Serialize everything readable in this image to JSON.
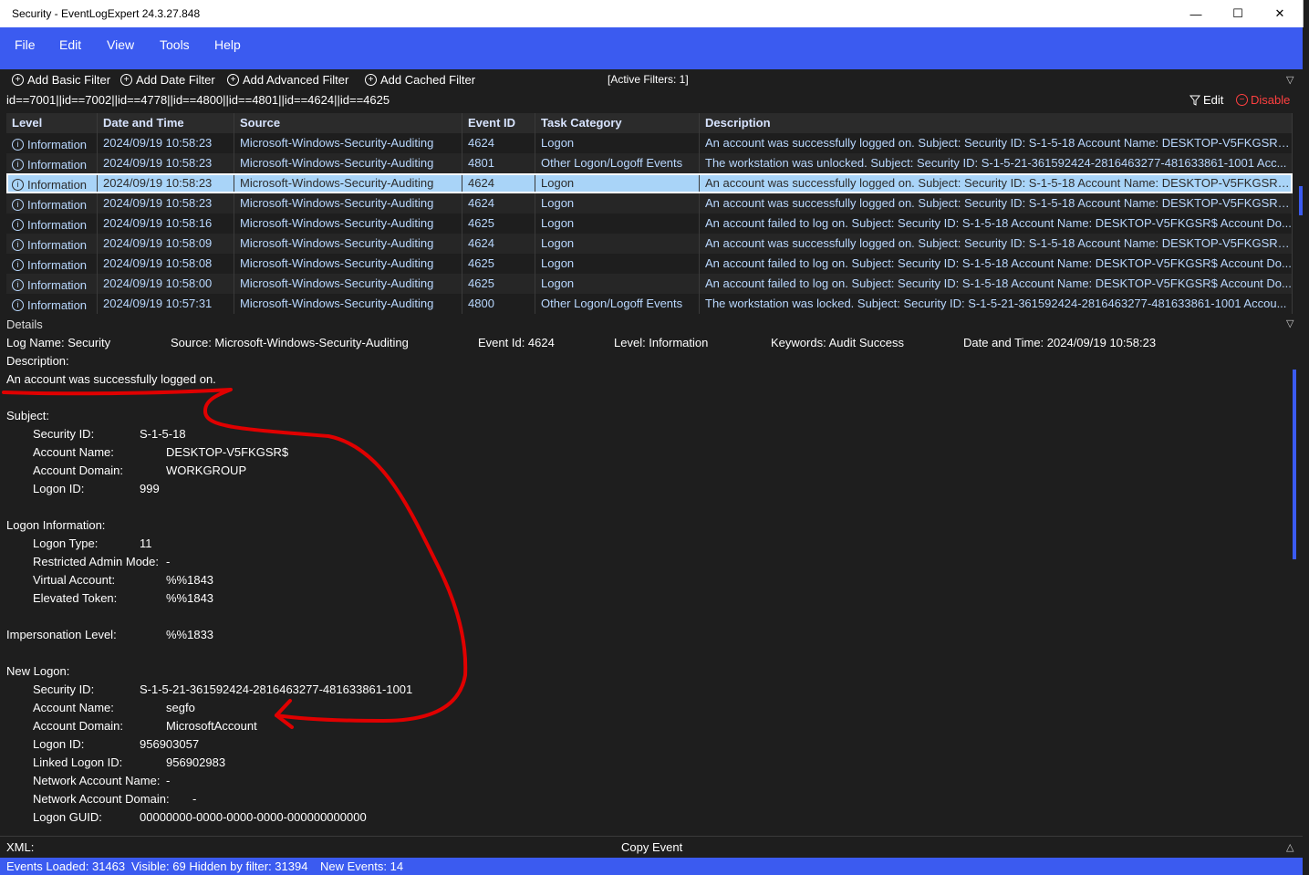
{
  "window": {
    "title": "Security - EventLogExpert 24.3.27.848",
    "minimize": "—",
    "maximize": "☐",
    "close": "✕"
  },
  "menu": [
    "File",
    "Edit",
    "View",
    "Tools",
    "Help"
  ],
  "filters": {
    "buttons": [
      "Add Basic Filter",
      "Add Date Filter",
      "Add Advanced Filter",
      "Add Cached Filter"
    ],
    "active": "[Active Filters: 1]",
    "expression": "id==7001||id==7002||id==4778||id==4800||id==4801||id==4624||id==4625",
    "edit_label": "Edit",
    "disable_label": "Disable"
  },
  "table": {
    "columns": [
      "Level",
      "Date and Time",
      "Source",
      "Event ID",
      "Task Category",
      "Description"
    ],
    "rows": [
      [
        "Information",
        "2024/09/19 10:58:23",
        "Microsoft-Windows-Security-Auditing",
        "4624",
        "Logon",
        "An account was successfully logged on. Subject: Security ID: S-1-5-18 Account Name: DESKTOP-V5FKGSR$ ..."
      ],
      [
        "Information",
        "2024/09/19 10:58:23",
        "Microsoft-Windows-Security-Auditing",
        "4801",
        "Other Logon/Logoff Events",
        "The workstation was unlocked. Subject: Security ID: S-1-5-21-361592424-2816463277-481633861-1001 Acc..."
      ],
      [
        "Information",
        "2024/09/19 10:58:23",
        "Microsoft-Windows-Security-Auditing",
        "4624",
        "Logon",
        "An account was successfully logged on. Subject: Security ID: S-1-5-18 Account Name: DESKTOP-V5FKGSR$ ..."
      ],
      [
        "Information",
        "2024/09/19 10:58:23",
        "Microsoft-Windows-Security-Auditing",
        "4624",
        "Logon",
        "An account was successfully logged on. Subject: Security ID: S-1-5-18 Account Name: DESKTOP-V5FKGSR$ ..."
      ],
      [
        "Information",
        "2024/09/19 10:58:16",
        "Microsoft-Windows-Security-Auditing",
        "4625",
        "Logon",
        "An account failed to log on. Subject: Security ID: S-1-5-18 Account Name: DESKTOP-V5FKGSR$ Account Do..."
      ],
      [
        "Information",
        "2024/09/19 10:58:09",
        "Microsoft-Windows-Security-Auditing",
        "4624",
        "Logon",
        "An account was successfully logged on. Subject: Security ID: S-1-5-18 Account Name: DESKTOP-V5FKGSR$ ..."
      ],
      [
        "Information",
        "2024/09/19 10:58:08",
        "Microsoft-Windows-Security-Auditing",
        "4625",
        "Logon",
        "An account failed to log on. Subject: Security ID: S-1-5-18 Account Name: DESKTOP-V5FKGSR$ Account Do..."
      ],
      [
        "Information",
        "2024/09/19 10:58:00",
        "Microsoft-Windows-Security-Auditing",
        "4625",
        "Logon",
        "An account failed to log on. Subject: Security ID: S-1-5-18 Account Name: DESKTOP-V5FKGSR$ Account Do..."
      ],
      [
        "Information",
        "2024/09/19 10:57:31",
        "Microsoft-Windows-Security-Auditing",
        "4800",
        "Other Logon/Logoff Events",
        "The workstation was locked. Subject: Security ID: S-1-5-21-361592424-2816463277-481633861-1001 Accou..."
      ]
    ],
    "selected_row": 2
  },
  "details": {
    "label": "Details",
    "log_name": "Log Name: Security",
    "source": "Source: Microsoft-Windows-Security-Auditing",
    "event_id": "Event Id: 4624",
    "level": "Level: Information",
    "keywords": "Keywords: Audit Success",
    "date_time": "Date and Time: 2024/09/19 10:58:23",
    "description_label": "Description:",
    "description": "An account was successfully logged on.",
    "subject_label": "Subject:",
    "subject": [
      [
        "Security ID:",
        "S-1-5-18"
      ],
      [
        "Account Name:",
        "DESKTOP-V5FKGSR$"
      ],
      [
        "Account Domain:",
        "WORKGROUP"
      ],
      [
        "Logon ID:",
        "999"
      ]
    ],
    "logon_info_label": "Logon Information:",
    "logon_info": [
      [
        "Logon Type:",
        "11"
      ],
      [
        "Restricted Admin Mode:",
        "-"
      ],
      [
        "Virtual Account:",
        "%%1843"
      ],
      [
        "Elevated Token:",
        "%%1843"
      ]
    ],
    "impersonation_label": "Impersonation Level:",
    "impersonation_value": "%%1833",
    "new_logon_label": "New Logon:",
    "new_logon": [
      [
        "Security ID:",
        "S-1-5-21-361592424-2816463277-481633861-1001"
      ],
      [
        "Account Name:",
        "segfo"
      ],
      [
        "Account Domain:",
        "MicrosoftAccount"
      ],
      [
        "Logon ID:",
        "956903057"
      ],
      [
        "Linked Logon ID:",
        "956902983"
      ],
      [
        "Network Account Name:",
        "-"
      ],
      [
        "Network Account Domain:",
        "-"
      ],
      [
        "Logon GUID:",
        "00000000-0000-0000-0000-000000000000"
      ]
    ]
  },
  "bottom": {
    "xml_label": "XML:",
    "copy_event": "Copy Event"
  },
  "status": {
    "loaded": "Events Loaded: 31463",
    "visible": "Visible: 69 Hidden by filter: 31394",
    "new_events": "New Events: 14"
  },
  "colors": {
    "accent": "#3b5bf0",
    "selection": "#a9d4f8",
    "disable": "#ff4040",
    "annotation": "#e00000"
  }
}
